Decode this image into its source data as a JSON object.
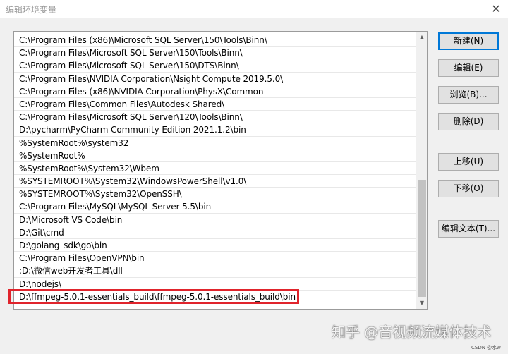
{
  "window": {
    "title": "编辑环境变量",
    "close_glyph": "✕"
  },
  "paths": [
    "C:\\Program Files (x86)\\Microsoft SQL Server\\150\\Tools\\Binn\\",
    "C:\\Program Files\\Microsoft SQL Server\\150\\Tools\\Binn\\",
    "C:\\Program Files\\Microsoft SQL Server\\150\\DTS\\Binn\\",
    "C:\\Program Files\\NVIDIA Corporation\\Nsight Compute 2019.5.0\\",
    "C:\\Program Files (x86)\\NVIDIA Corporation\\PhysX\\Common",
    "C:\\Program Files\\Common Files\\Autodesk Shared\\",
    "C:\\Program Files\\Microsoft SQL Server\\120\\Tools\\Binn\\",
    "D:\\pycharm\\PyCharm Community Edition 2021.1.2\\bin",
    "%SystemRoot%\\system32",
    "%SystemRoot%",
    "%SystemRoot%\\System32\\Wbem",
    "%SYSTEMROOT%\\System32\\WindowsPowerShell\\v1.0\\",
    "%SYSTEMROOT%\\System32\\OpenSSH\\",
    "C:\\Program Files\\MySQL\\MySQL Server 5.5\\bin",
    "D:\\Microsoft VS Code\\bin",
    "D:\\Git\\cmd",
    "D:\\golang_sdk\\go\\bin",
    "C:\\Program Files\\OpenVPN\\bin",
    ";D:\\微信web开发者工具\\dll",
    "D:\\nodejs\\",
    "D:\\ffmpeg-5.0.1-essentials_build\\ffmpeg-5.0.1-essentials_build\\bin"
  ],
  "buttons": {
    "new": "新建(N)",
    "edit": "编辑(E)",
    "browse": "浏览(B)...",
    "delete": "删除(D)",
    "move_up": "上移(U)",
    "move_down": "下移(O)",
    "edit_text": "编辑文本(T)..."
  },
  "scrollbar": {
    "up_glyph": "▲",
    "down_glyph": "▼"
  },
  "watermark": {
    "main": "知乎 @音视频流媒体技术",
    "small": "CSDN @水w"
  },
  "colors": {
    "highlight": "#e0242c",
    "button_focus": "#0078d7"
  }
}
